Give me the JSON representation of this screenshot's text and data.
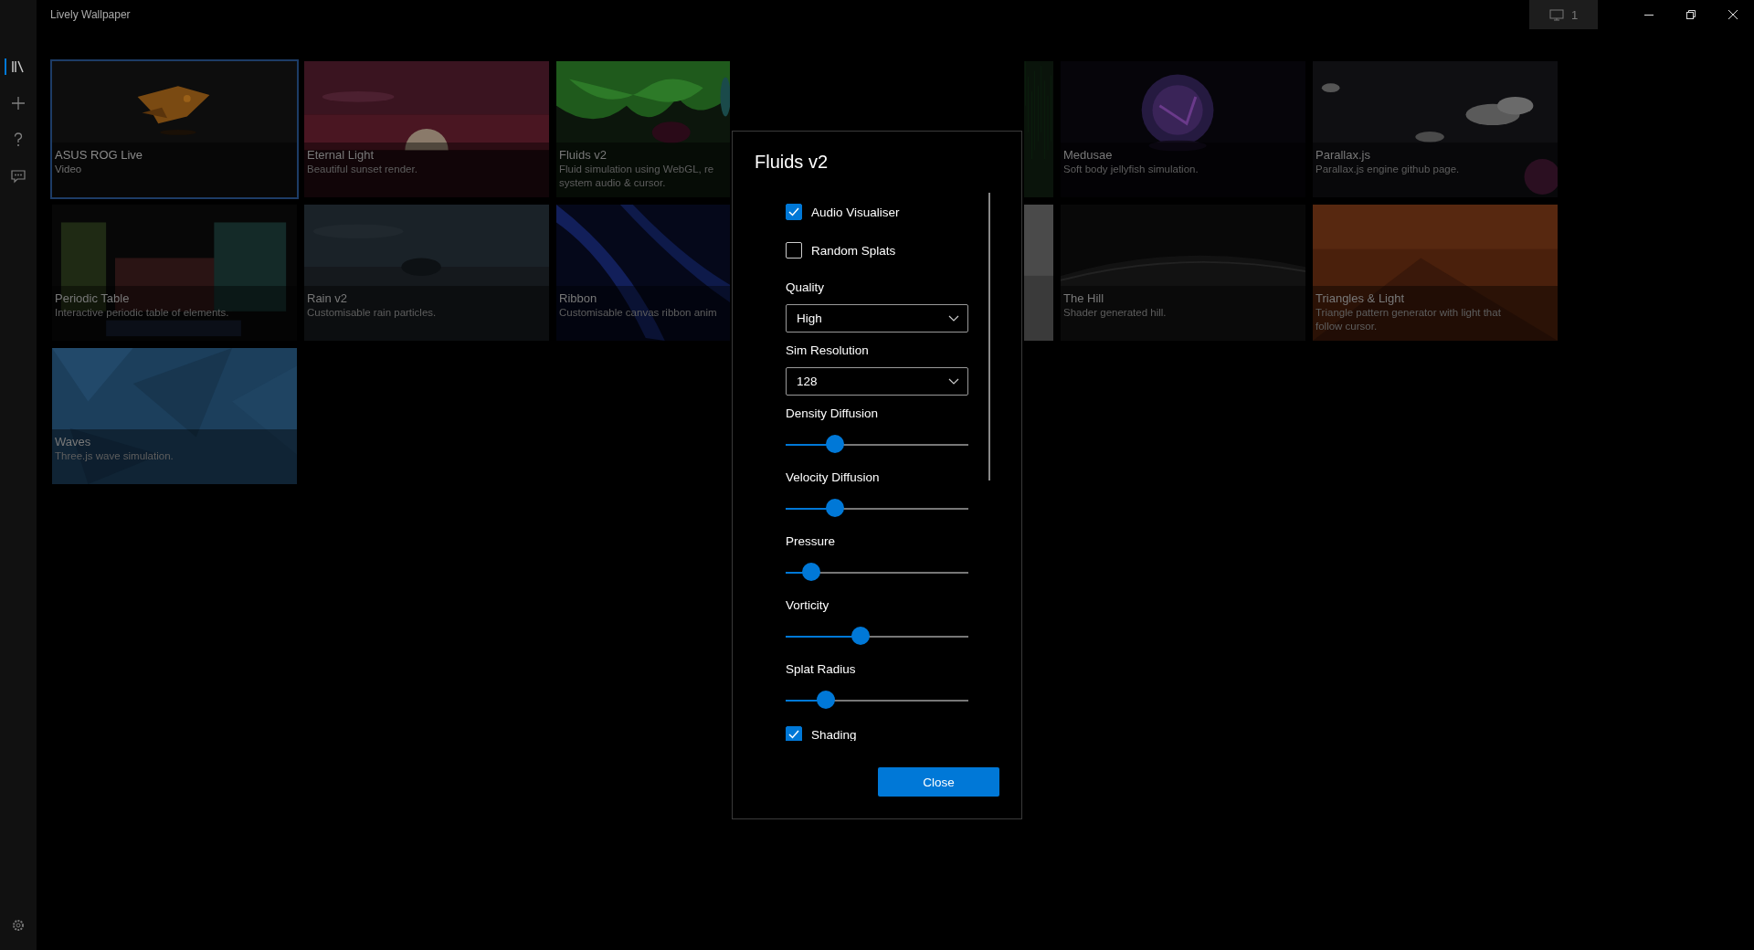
{
  "window": {
    "title": "Lively Wallpaper",
    "monitor_button": "1"
  },
  "sidebar": {
    "items": [
      {
        "selected": true
      },
      {
        "selected": false
      },
      {
        "selected": false
      },
      {
        "selected": false
      }
    ]
  },
  "cards": [
    {
      "title": "ASUS ROG Live",
      "description": [
        "Video"
      ],
      "selected": true
    },
    {
      "title": "Eternal Light",
      "description": [
        "Beautiful sunset render."
      ],
      "selected": false
    },
    {
      "title": "Fluids v2",
      "description": [
        "Fluid simulation using WebGL, re",
        "system audio & cursor."
      ],
      "selected": false
    },
    {
      "selected": false
    },
    {
      "title": "Medusae",
      "description": [
        "Soft body jellyfish simulation."
      ],
      "selected": false
    },
    {
      "title": "Parallax.js",
      "description": [
        "Parallax.js engine github page."
      ],
      "selected": false
    },
    {
      "title": "Periodic Table",
      "description": [
        "Interactive periodic table of elements."
      ],
      "selected": false
    },
    {
      "title": "Rain v2",
      "description": [
        "Customisable rain particles."
      ],
      "selected": false
    },
    {
      "title": "Ribbon",
      "description": [
        "Customisable canvas ribbon anim"
      ],
      "selected": false
    },
    {
      "selected": false
    },
    {
      "title": "The Hill",
      "description": [
        "Shader generated hill."
      ],
      "selected": false
    },
    {
      "title": "Triangles & Light",
      "description": [
        "Triangle pattern generator with light that",
        "follow cursor."
      ],
      "selected": false
    },
    {
      "title": "Waves",
      "description": [
        "Three.js wave simulation."
      ],
      "selected": false
    }
  ],
  "dialog": {
    "title": "Fluids v2",
    "settings": [
      {
        "kind": "checkbox",
        "label": "Audio Visualiser",
        "checked": true
      },
      {
        "kind": "checkbox",
        "label": "Random Splats",
        "checked": false
      },
      {
        "kind": "dropdown",
        "label": "Quality",
        "value": "High"
      },
      {
        "kind": "dropdown",
        "label": "Sim Resolution",
        "value": "128"
      },
      {
        "kind": "slider",
        "label": "Density Diffusion",
        "level": 0.27
      },
      {
        "kind": "slider",
        "label": "Velocity Diffusion",
        "level": 0.27
      },
      {
        "kind": "slider",
        "label": "Pressure",
        "level": 0.14
      },
      {
        "kind": "slider",
        "label": "Vorticity",
        "level": 0.41
      },
      {
        "kind": "slider",
        "label": "Splat Radius",
        "level": 0.22
      },
      {
        "kind": "checkbox",
        "label": "Shading",
        "checked": true
      }
    ],
    "button": "Close"
  }
}
